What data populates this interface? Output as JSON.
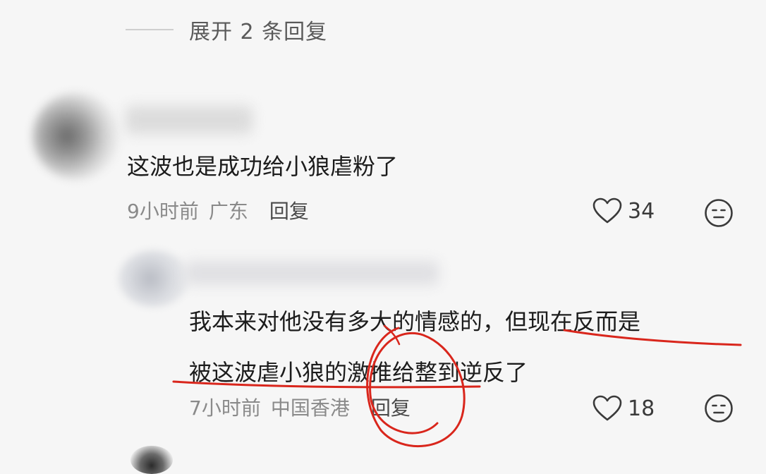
{
  "expand_replies": {
    "label": "展开 2 条回复"
  },
  "comments": [
    {
      "text": "这波也是成功给小狼虐粉了",
      "time": "9小时前",
      "location": "广东",
      "reply_label": "回复",
      "likes": "34"
    },
    {
      "lines": [
        "我本来对他没有多大的情感的，但现在反而是",
        "被这波虐小狼的激推给整到逆反了"
      ],
      "time": "7小时前",
      "location": "中国香港",
      "reply_label": "回复",
      "likes": "18"
    }
  ],
  "icons": {
    "like": "heart-outline-icon",
    "dislike": "neutral-face-icon"
  },
  "colors": {
    "annotation": "#d9261c",
    "meta_text": "#8a8a8a",
    "background": "#f6f6f6"
  }
}
